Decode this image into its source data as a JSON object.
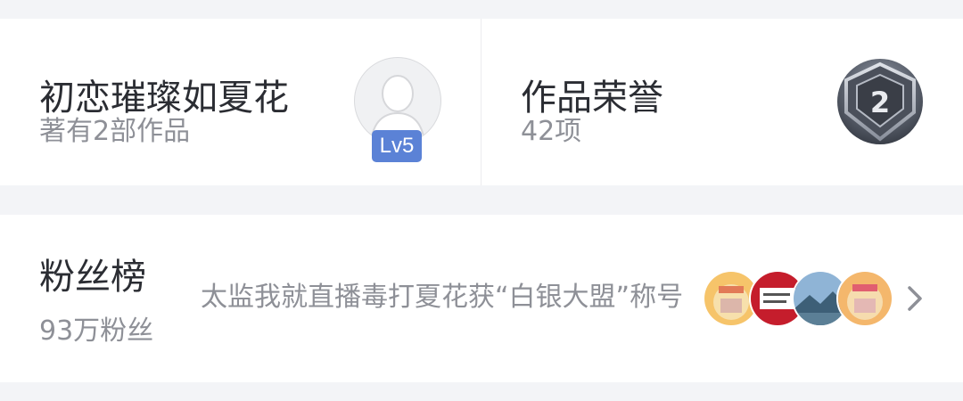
{
  "author": {
    "name": "初恋璀璨如夏花",
    "works": "著有2部作品",
    "level": "Lv5"
  },
  "honor": {
    "title": "作品荣誉",
    "count": "42项",
    "medal_number": "2"
  },
  "fans": {
    "title": "粉丝榜",
    "count": "93万粉丝",
    "news": "太监我就直播毒打夏花获“白银大盟”称号"
  },
  "icons": {
    "avatar": "person-silhouette-icon",
    "medal": "silver-medal-icon",
    "chevron": "chevron-right-icon"
  },
  "colors": {
    "background": "#f3f4f7",
    "card": "#ffffff",
    "title": "#2b2d33",
    "secondary": "#8e9097",
    "level_badge": "#5b82d6"
  }
}
